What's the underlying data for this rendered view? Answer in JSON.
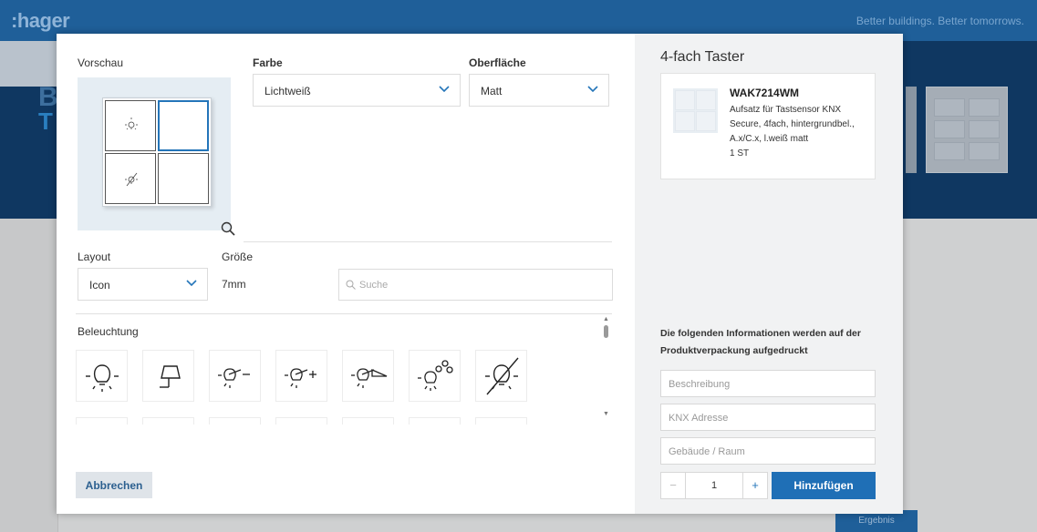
{
  "background": {
    "logo": ":hager",
    "tagline": "Better buildings. Better tomorrows.",
    "hero_title_1": "B",
    "hero_title_2": "T",
    "results_button": "Ergebnis"
  },
  "preview": {
    "label": "Vorschau",
    "zoom_icon": "magnifier-icon"
  },
  "color_select": {
    "label": "Farbe",
    "value": "Lichtweiß"
  },
  "surface_select": {
    "label": "Oberfläche",
    "value": "Matt"
  },
  "layout_select": {
    "label": "Layout",
    "value": "Icon"
  },
  "size": {
    "label": "Größe",
    "value": "7mm"
  },
  "search": {
    "placeholder": "Suche"
  },
  "icon_category": {
    "label": "Beleuchtung",
    "icons": [
      "lamp-on-icon",
      "floor-lamp-icon",
      "dimmer-minus-icon",
      "dimmer-plus-icon",
      "dimmer-ramp-icon",
      "scene-lamp-icon",
      "lamp-off-icon"
    ]
  },
  "cancel_button": "Abbrechen",
  "right_panel": {
    "title": "4-fach Taster",
    "product": {
      "code": "WAK7214WM",
      "description_lines": [
        "Aufsatz für Tastsensor KNX",
        "Secure, 4fach, hintergrundbel.,",
        "A.x/C.x, l.weiß matt",
        "1 ST"
      ]
    },
    "info_text": "Die folgenden Informationen werden auf der Produktverpackung aufgedruckt",
    "fields": {
      "description": "Beschreibung",
      "knx_address": "KNX Adresse",
      "building_room": "Gebäude / Raum"
    },
    "quantity": {
      "minus": "−",
      "value": "1",
      "plus": "+"
    },
    "add_button": "Hinzufügen"
  },
  "colors": {
    "accent": "#1f6fb6",
    "header": "#1f5f99",
    "selected_key": "#2475b9"
  }
}
